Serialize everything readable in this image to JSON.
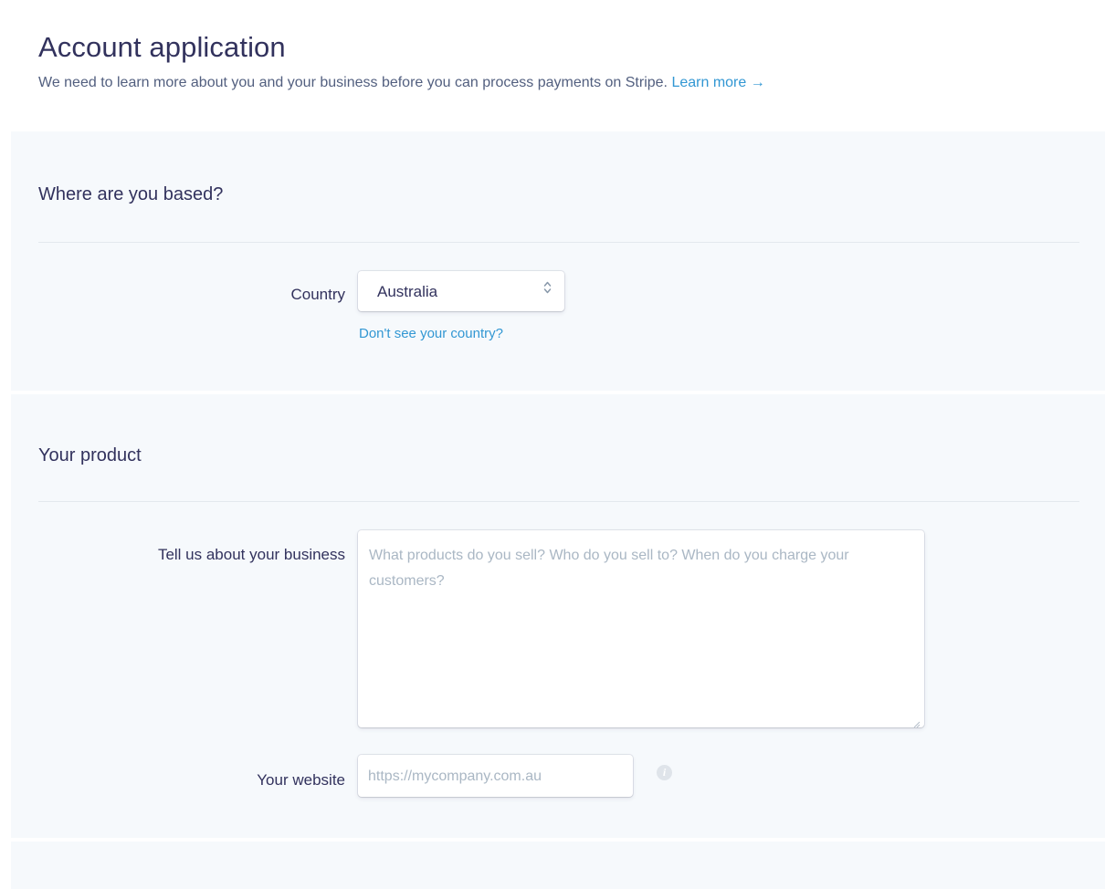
{
  "header": {
    "title": "Account application",
    "subtitle": "We need to learn more about you and your business before you can process payments on Stripe.",
    "learn_more": "Learn more",
    "learn_more_arrow": "→"
  },
  "location_section": {
    "title": "Where are you based?",
    "country_label": "Country",
    "country_value": "Australia",
    "help_link": "Don't see your country?"
  },
  "product_section": {
    "title": "Your product",
    "business_label": "Tell us about your business",
    "business_placeholder": "What products do you sell? Who do you sell to? When do you charge your customers?",
    "website_label": "Your website",
    "website_placeholder": "https://mycompany.com.au",
    "info_icon": "i"
  },
  "colors": {
    "accent": "#3297d3",
    "section_bg": "#f6f9fc",
    "text": "#32325d",
    "placeholder": "#aab7c4"
  },
  "icons": {
    "select_caret": "chevron-up-down-icon",
    "info": "info-icon",
    "arrow": "arrow-right-icon"
  }
}
